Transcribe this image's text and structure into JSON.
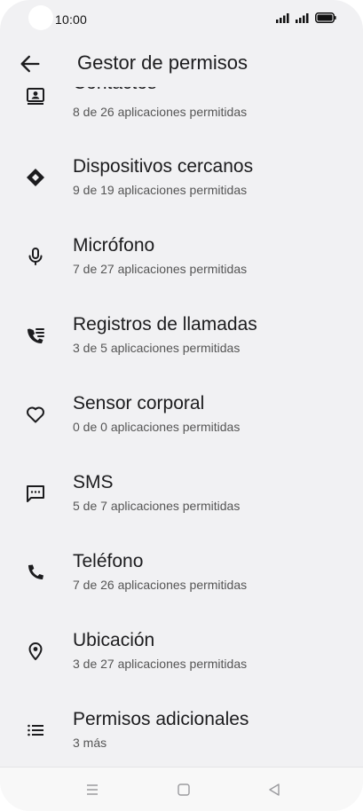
{
  "status_bar": {
    "time": "10:00",
    "icons": [
      "signal-icon",
      "signal-icon",
      "battery-icon"
    ]
  },
  "app_bar": {
    "title": "Gestor de permisos",
    "back_icon": "arrow-back-icon"
  },
  "permissions": [
    {
      "label": "Contactos",
      "sub": "8 de 26 aplicaciones permitidas",
      "icon": "contacts-icon"
    },
    {
      "label": "Dispositivos cercanos",
      "sub": "9 de 19 aplicaciones permitidas",
      "icon": "nearby-devices-icon"
    },
    {
      "label": "Micrófono",
      "sub": "7 de 27 aplicaciones permitidas",
      "icon": "microphone-icon"
    },
    {
      "label": "Registros de llamadas",
      "sub": "3 de 5 aplicaciones permitidas",
      "icon": "call-log-icon"
    },
    {
      "label": "Sensor corporal",
      "sub": "0 de 0 aplicaciones permitidas",
      "icon": "heart-icon"
    },
    {
      "label": "SMS",
      "sub": "5 de 7 aplicaciones permitidas",
      "icon": "sms-icon"
    },
    {
      "label": "Teléfono",
      "sub": "7 de 26 aplicaciones permitidas",
      "icon": "phone-icon"
    },
    {
      "label": "Ubicación",
      "sub": "3 de 27 aplicaciones permitidas",
      "icon": "location-icon"
    },
    {
      "label": "Permisos adicionales",
      "sub": "3 más",
      "icon": "list-icon"
    }
  ],
  "nav_bar": {
    "icons": [
      "menu-icon",
      "home-square-icon",
      "back-triangle-icon"
    ]
  }
}
